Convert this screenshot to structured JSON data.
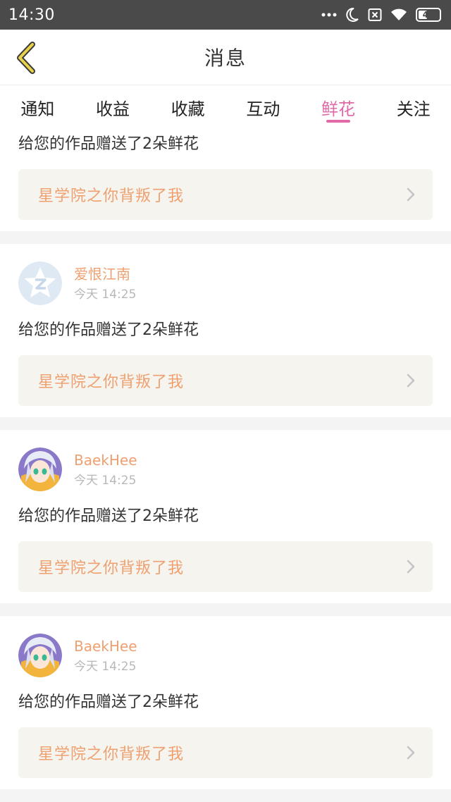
{
  "status_bar": {
    "time": "14:30",
    "battery": "44",
    "battery_fraction": 0.44,
    "icons": [
      "more-dots-icon",
      "moon-icon",
      "sim-off-icon",
      "wifi-icon",
      "battery-icon"
    ]
  },
  "header": {
    "title": "消息",
    "back_icon": "chevron-left-icon",
    "accent_color": "#e8d24a"
  },
  "tabs": [
    {
      "label": "通知",
      "active": false
    },
    {
      "label": "收益",
      "active": false
    },
    {
      "label": "收藏",
      "active": false
    },
    {
      "label": "互动",
      "active": false
    },
    {
      "label": "鲜花",
      "active": true
    },
    {
      "label": "关注",
      "active": false
    }
  ],
  "colors": {
    "active_tab": "#e06aa8",
    "username": "#f0a070",
    "work_title": "#f0a070",
    "work_bg": "#f5f4ee"
  },
  "feed": [
    {
      "message": "给您的作品赠送了2朵鲜花",
      "work_title": "星学院之你背叛了我"
    },
    {
      "username": "爱恨江南",
      "time": "今天 14:25",
      "avatar": "default-star-avatar",
      "message": "给您的作品赠送了2朵鲜花",
      "work_title": "星学院之你背叛了我"
    },
    {
      "username": "BaekHee",
      "time": "今天 14:25",
      "avatar": "anime-character-avatar",
      "message": "给您的作品赠送了2朵鲜花",
      "work_title": "星学院之你背叛了我"
    },
    {
      "username": "BaekHee",
      "time": "今天 14:25",
      "avatar": "anime-character-avatar",
      "message": "给您的作品赠送了2朵鲜花",
      "work_title": "星学院之你背叛了我"
    }
  ]
}
